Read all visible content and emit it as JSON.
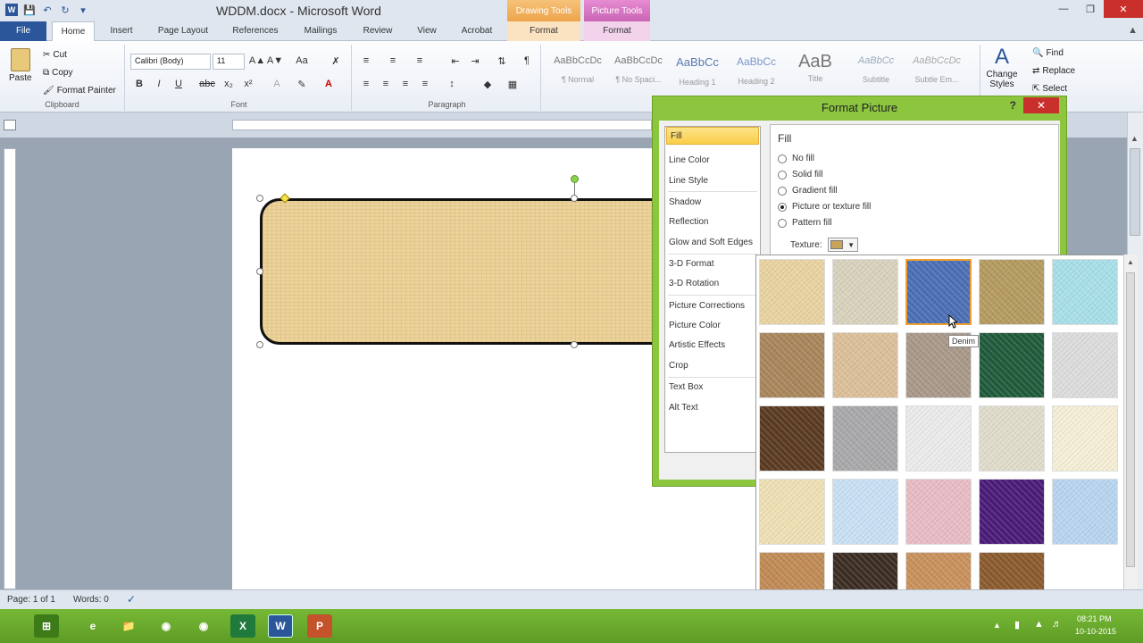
{
  "app": {
    "title": "WDDM.docx - Microsoft Word",
    "context_tabs": {
      "drawing_tools": "Drawing Tools",
      "picture_tools": "Picture Tools"
    }
  },
  "qat": {
    "icons": [
      "word-icon",
      "save-icon",
      "undo-icon",
      "redo-icon",
      "customize-icon"
    ]
  },
  "tabs": [
    {
      "label": "File"
    },
    {
      "label": "Home"
    },
    {
      "label": "Insert"
    },
    {
      "label": "Page Layout"
    },
    {
      "label": "References"
    },
    {
      "label": "Mailings"
    },
    {
      "label": "Review"
    },
    {
      "label": "View"
    },
    {
      "label": "Acrobat"
    },
    {
      "label": "Format"
    },
    {
      "label": "Format"
    }
  ],
  "ribbon": {
    "clipboard": {
      "label": "Clipboard",
      "paste": "Paste",
      "cut": "Cut",
      "copy": "Copy",
      "format_painter": "Format Painter"
    },
    "font": {
      "label": "Font",
      "name": "Calibri (Body)",
      "size": "11"
    },
    "paragraph": {
      "label": "Paragraph"
    },
    "styles": [
      {
        "sample": "AaBbCcDc",
        "name": "¶ Normal"
      },
      {
        "sample": "AaBbCcDc",
        "name": "¶ No Spaci..."
      },
      {
        "sample": "AaBbCc",
        "name": "Heading 1"
      },
      {
        "sample": "AaBbCc",
        "name": "Heading 2"
      },
      {
        "sample": "AaB",
        "name": "Title"
      },
      {
        "sample": "AaBbCc",
        "name": "Subtitle"
      },
      {
        "sample": "AaBbCcDc",
        "name": "Subtle Em..."
      }
    ],
    "change_styles": "Change Styles",
    "editing": {
      "find": "Find",
      "replace": "Replace",
      "select": "Select"
    }
  },
  "dialog": {
    "title": "Format Picture",
    "help": "?",
    "categories": [
      {
        "label": "Fill",
        "selected": true
      },
      {
        "label": "Line Color"
      },
      {
        "label": "Line Style"
      },
      {
        "label": "Shadow"
      },
      {
        "label": "Reflection"
      },
      {
        "label": "Glow and Soft Edges"
      },
      {
        "label": "3-D Format"
      },
      {
        "label": "3-D Rotation"
      },
      {
        "label": "Picture Corrections"
      },
      {
        "label": "Picture Color"
      },
      {
        "label": "Artistic Effects"
      },
      {
        "label": "Crop"
      },
      {
        "label": "Text Box"
      },
      {
        "label": "Alt Text"
      }
    ],
    "fill_title": "Fill",
    "fill_options": [
      {
        "label": "No fill",
        "checked": false
      },
      {
        "label": "Solid fill",
        "checked": false
      },
      {
        "label": "Gradient fill",
        "checked": false
      },
      {
        "label": "Picture or texture fill",
        "checked": true
      },
      {
        "label": "Pattern fill",
        "checked": false
      }
    ],
    "texture_label": "Texture:"
  },
  "textures": [
    {
      "name": "Papyrus",
      "color": "#e8d3a0"
    },
    {
      "name": "Canvas",
      "color": "#d8d2bd"
    },
    {
      "name": "Denim",
      "color": "#4a6fb5",
      "selected": true
    },
    {
      "name": "Woven mat",
      "color": "#b49a5e"
    },
    {
      "name": "Water droplets",
      "color": "#a7dfe8"
    },
    {
      "name": "Paper bag",
      "color": "#a8855a"
    },
    {
      "name": "Fish fossil",
      "color": "#dcbf98"
    },
    {
      "name": "Sand",
      "color": "#a89888"
    },
    {
      "name": "Green marble",
      "color": "#1f5a3a"
    },
    {
      "name": "White marble",
      "color": "#dcdcdc"
    },
    {
      "name": "Brown marble",
      "color": "#5a3a20"
    },
    {
      "name": "Granite",
      "color": "#a8a8aa"
    },
    {
      "name": "Newsprint",
      "color": "#ebebeb"
    },
    {
      "name": "Recycled paper",
      "color": "#e0dccb"
    },
    {
      "name": "Parchment",
      "color": "#f6efd6"
    },
    {
      "name": "Stationery",
      "color": "#efe0b4"
    },
    {
      "name": "Blue tissue paper",
      "color": "#c8e0f4"
    },
    {
      "name": "Pink tissue paper",
      "color": "#e8bcc4"
    },
    {
      "name": "Purple mesh",
      "color": "#4a1a78"
    },
    {
      "name": "Bouquet",
      "color": "#b8d4f0"
    },
    {
      "name": "Cork",
      "color": "#c08a54"
    },
    {
      "name": "Walnut",
      "color": "#3a2c22"
    },
    {
      "name": "Oak",
      "color": "#c8905a"
    },
    {
      "name": "Medium wood",
      "color": "#8a5a2c"
    }
  ],
  "tooltip": "Denim",
  "status": {
    "page": "Page: 1 of 1",
    "words": "Words: 0"
  },
  "taskbar": {
    "icons": [
      "start-icon",
      "ie-icon",
      "explorer-icon",
      "chrome-icon",
      "firefox-icon",
      "excel-icon",
      "word-icon",
      "powerpoint-icon"
    ],
    "time": "08:21 PM",
    "date": "10-10-2015"
  },
  "colors": {
    "accent": "#2b579a",
    "dialog_frame": "#8cc63f",
    "taskbar": "#6aa82d",
    "close_red": "#c9302c"
  }
}
